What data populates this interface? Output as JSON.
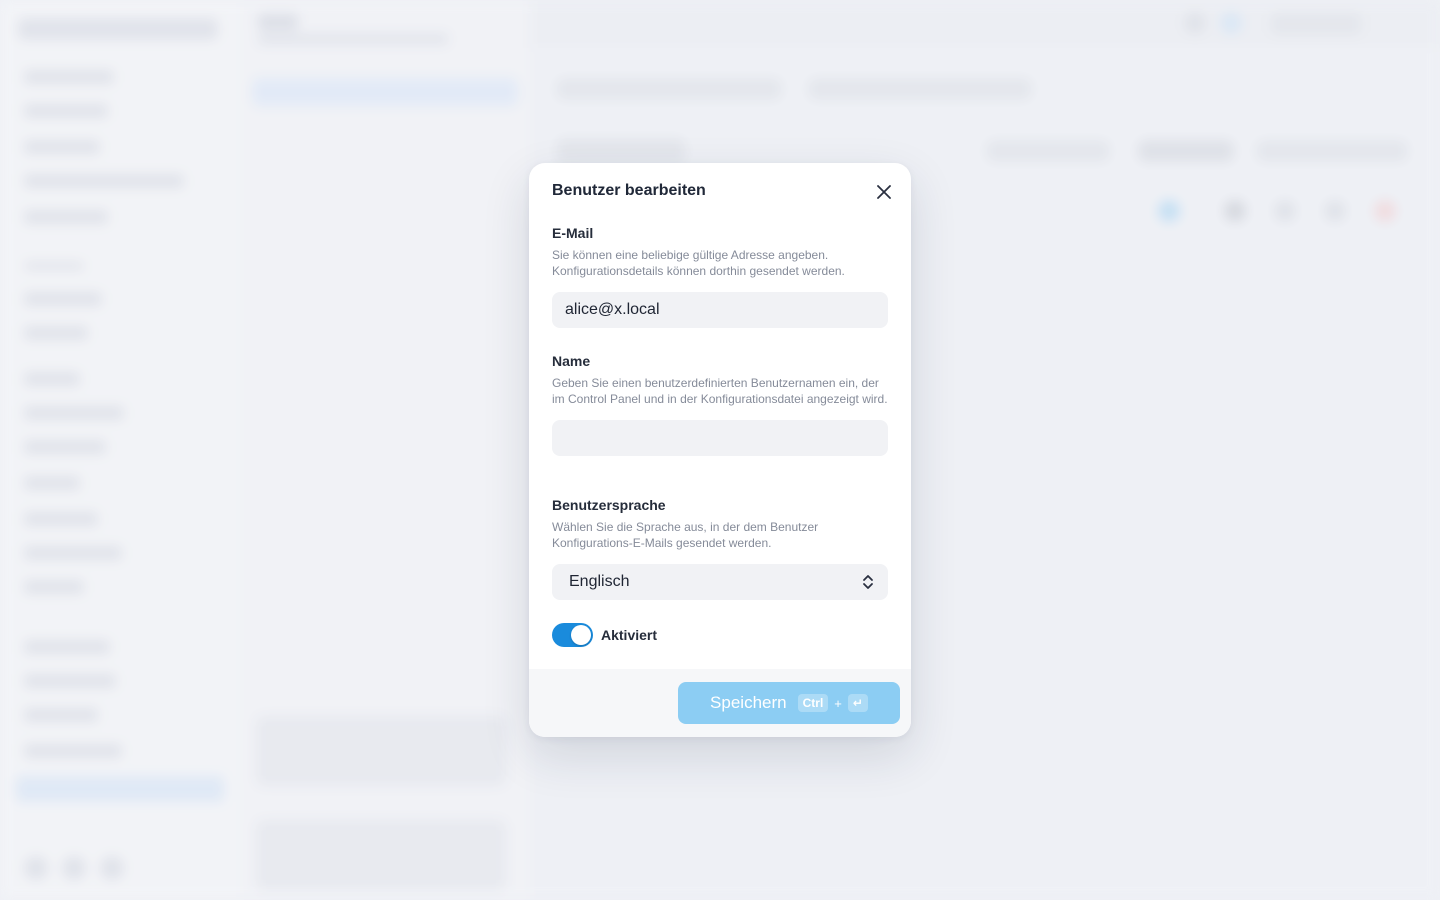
{
  "modal": {
    "title": "Benutzer bearbeiten",
    "email": {
      "label": "E-Mail",
      "help": "Sie können eine beliebige gültige Adresse angeben. Konfigurationsdetails können dorthin gesendet werden.",
      "value": "alice@x.local"
    },
    "name": {
      "label": "Name",
      "help": "Geben Sie einen benutzerdefinierten Benutzernamen ein, der im Control Panel und in der Konfigurationsdatei angezeigt wird.",
      "value": ""
    },
    "language": {
      "label": "Benutzersprache",
      "help": "Wählen Sie die Sprache aus, in der dem Benutzer Konfigurations-E-Mails gesendet werden.",
      "selected": "Englisch"
    },
    "enabled": {
      "label": "Aktiviert",
      "on": true
    },
    "save": {
      "label": "Speichern",
      "shortcut_key1": "Ctrl",
      "shortcut_plus": "+",
      "shortcut_key2": "↵"
    }
  },
  "colors": {
    "accent": "#1a8bdc",
    "save_button": "#8ccdf3"
  },
  "icons": {
    "close": "close-icon",
    "select": "chevron-up-down-icon"
  }
}
